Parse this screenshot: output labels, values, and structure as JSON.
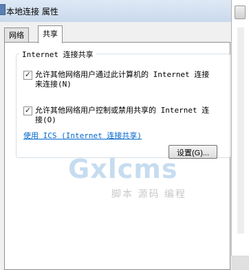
{
  "window": {
    "title": "本地连接 属性"
  },
  "tabs": [
    {
      "label": "网络"
    },
    {
      "label": "共享"
    }
  ],
  "sharing": {
    "group_title": "Internet 连接共享",
    "option1": {
      "checked": true,
      "line1": "允许其他网络用户通过此计算机的 Internet 连接",
      "line2": "来连接(N)"
    },
    "option2": {
      "checked": true,
      "line1": "允许其他网络用户控制或禁用共享的 Internet 连",
      "line2": "接(O)"
    },
    "ics_link": "使用 ICS (Internet 连接共享)",
    "settings_button": "设置(G)..."
  },
  "watermark": {
    "main": "Gxlcms",
    "sub": "脚本 源码 编程"
  }
}
